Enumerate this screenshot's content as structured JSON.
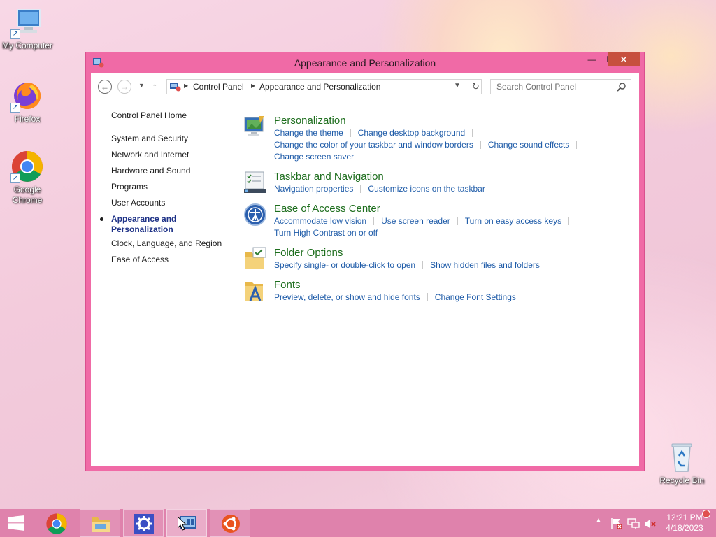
{
  "desktop": {
    "icons": [
      {
        "label": "My Computer"
      },
      {
        "label": "Firefox"
      },
      {
        "label": "Google Chrome"
      },
      {
        "label": "Recycle Bin"
      }
    ]
  },
  "window": {
    "title": "Appearance and Personalization",
    "controls": {
      "minimize": "—",
      "maximize": "☐",
      "close": "✕"
    }
  },
  "addressbar": {
    "back": "←",
    "forward": "→",
    "up": "↑",
    "breadcrumbs": [
      "Control Panel",
      "Appearance and Personalization"
    ],
    "refresh": "↻"
  },
  "search": {
    "placeholder": "Search Control Panel"
  },
  "leftnav": {
    "home": "Control Panel Home",
    "items": [
      "System and Security",
      "Network and Internet",
      "Hardware and Sound",
      "Programs",
      "User Accounts",
      "Appearance and",
      "Personalization",
      "Clock, Language, and Region",
      "Ease of Access"
    ]
  },
  "categories": [
    {
      "title": "Personalization",
      "icon": "personalization-icon",
      "links": [
        "Change the theme",
        "Change desktop background",
        "Change the color of your taskbar and window borders",
        "Change sound effects",
        "Change screen saver"
      ]
    },
    {
      "title": "Taskbar and Navigation",
      "icon": "taskbar-icon",
      "links": [
        "Navigation properties",
        "Customize icons on the taskbar"
      ]
    },
    {
      "title": "Ease of Access Center",
      "icon": "ease-of-access-icon",
      "links": [
        "Accommodate low vision",
        "Use screen reader",
        "Turn on easy access keys",
        "Turn High Contrast on or off"
      ]
    },
    {
      "title": "Folder Options",
      "icon": "folder-options-icon",
      "links": [
        "Specify single- or double-click to open",
        "Show hidden files and folders"
      ]
    },
    {
      "title": "Fonts",
      "icon": "fonts-icon",
      "links": [
        "Preview, delete, or show and hide fonts",
        "Change Font Settings"
      ]
    }
  ],
  "taskbar": {
    "items": [
      "start-icon",
      "chrome-icon",
      "file-explorer-icon",
      "settings-icon",
      "control-panel-icon",
      "ubuntu-icon"
    ],
    "tray": {
      "chevron": "▲"
    },
    "clock": {
      "time": "12:21 PM",
      "date": "4/18/2023"
    }
  },
  "colors": {
    "window_frame": "#f06aa6",
    "close_button": "#c7503e",
    "link": "#1e5ba8",
    "category_title": "#1e6e1e",
    "taskbar": "#df82ac"
  }
}
